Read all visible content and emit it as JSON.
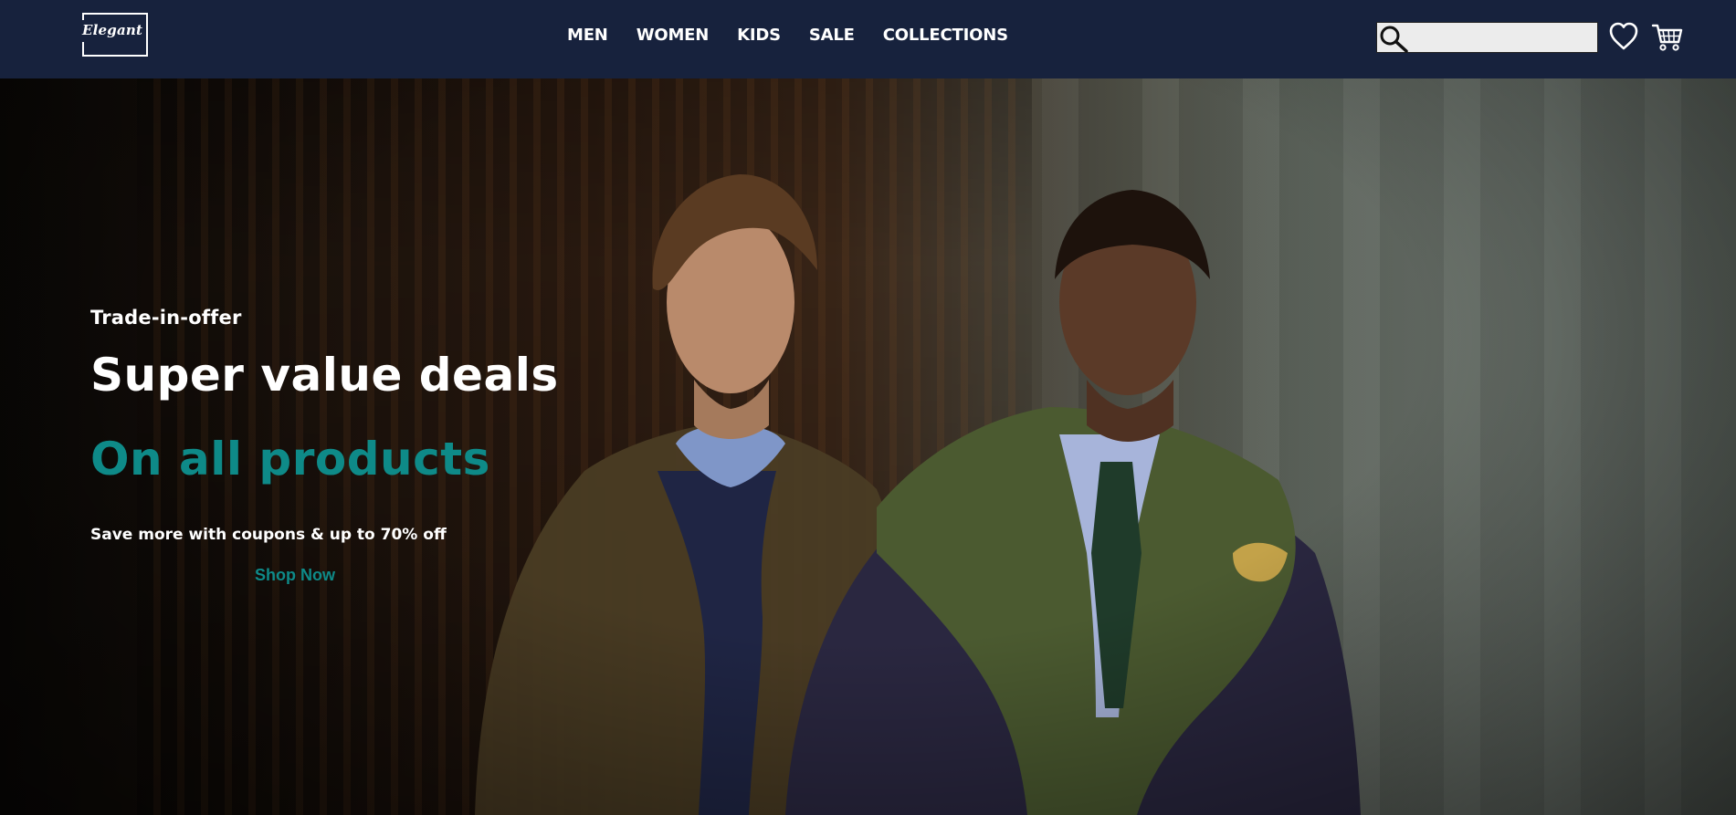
{
  "brand": {
    "logo_text": "Elegant"
  },
  "nav": {
    "items": [
      {
        "label": "MEN"
      },
      {
        "label": "WOMEN"
      },
      {
        "label": "KIDS"
      },
      {
        "label": "SALE"
      },
      {
        "label": "COLLECTIONS"
      }
    ]
  },
  "search": {
    "value": "",
    "placeholder": ""
  },
  "header_icons": {
    "search_icon": "search-icon",
    "wishlist_icon": "heart-icon",
    "cart_icon": "cart-icon"
  },
  "hero": {
    "eyebrow": "Trade-in-offer",
    "headline": "Super value deals",
    "subheadline": "On all products",
    "description": "Save more with coupons & up to 70% off",
    "cta_label": "Shop Now"
  },
  "colors": {
    "header_bg": "#17223d",
    "accent_teal": "#0e8a88",
    "text_white": "#ffffff",
    "search_bg": "#ececec"
  }
}
